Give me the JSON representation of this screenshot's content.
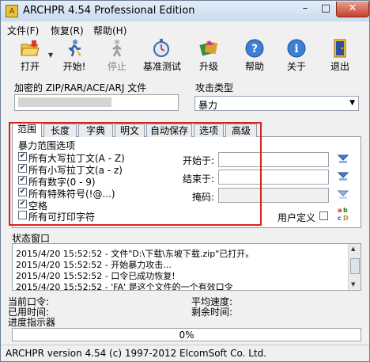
{
  "window": {
    "title": "ARCHPR 4.54 Professional Edition",
    "minimize": "–",
    "maximize": "□",
    "close": "✕"
  },
  "menu": [
    "文件(F)",
    "恢复(R)",
    "帮助(H)"
  ],
  "toolbar": [
    {
      "label": "打开",
      "icon": "open-folder-icon",
      "enabled": true
    },
    {
      "label": "开始!",
      "icon": "start-runner-icon",
      "enabled": true
    },
    {
      "label": "停止",
      "icon": "stop-runner-icon",
      "enabled": false
    },
    {
      "label": "基准测试",
      "icon": "stopwatch-icon",
      "enabled": true
    },
    {
      "label": "升级",
      "icon": "upgrade-icon",
      "enabled": true
    },
    {
      "label": "帮助",
      "icon": "help-icon",
      "enabled": true
    },
    {
      "label": "关于",
      "icon": "info-icon",
      "enabled": true
    },
    {
      "label": "退出",
      "icon": "exit-door-icon",
      "enabled": true
    }
  ],
  "encrypted_file": {
    "label": "加密的 ZIP/RAR/ACE/ARJ 文件",
    "value": ""
  },
  "attack_type": {
    "label": "攻击类型",
    "value": "暴力"
  },
  "tabs": [
    "范围",
    "长度",
    "字典",
    "明文",
    "自动保存",
    "选项",
    "高级"
  ],
  "active_tab": 0,
  "range": {
    "group_title": "暴力范围选项",
    "options": [
      {
        "label": "所有大写拉丁文(A - Z)",
        "checked": true
      },
      {
        "label": "所有小写拉丁文(a - z)",
        "checked": true
      },
      {
        "label": "所有数字(0 - 9)",
        "checked": true
      },
      {
        "label": "所有特殊符号(!@...)",
        "checked": true
      },
      {
        "label": "空格",
        "checked": true
      },
      {
        "label": "所有可打印字符",
        "checked": false
      }
    ],
    "start_label": "开始于:",
    "end_label": "结束于:",
    "mask_label": "掩码:",
    "start_value": "",
    "end_value": "",
    "mask_value": "",
    "user_defined_label": "用户定义",
    "user_defined_checked": false
  },
  "status": {
    "group_title": "状态窗口",
    "log": [
      "2015/4/20 15:52:52 - 文件\"D:\\下载\\东坡下载.zip\"已打开。",
      "2015/4/20 15:52:52 - 开始暴力攻击...",
      "2015/4/20 15:52:52 - 口令已成功恢复!",
      "2015/4/20 15:52:52 - 'FA' 是这个文件的一个有效口令"
    ],
    "current_password_label": "当前口令:",
    "current_password": "",
    "elapsed_label": "已用时间:",
    "elapsed": "",
    "progress_indicator_label": "进度指示器",
    "avg_speed_label": "平均速度:",
    "avg_speed": "",
    "remaining_label": "剩余时间:",
    "remaining": ""
  },
  "progress": {
    "percent": 0,
    "text": "0%"
  },
  "statusbar": "ARCHPR version 4.54 (c) 1997-2012 ElcomSoft Co. Ltd.",
  "colors": {
    "highlight": "#e0201c",
    "progress": "#3c9a3c"
  }
}
